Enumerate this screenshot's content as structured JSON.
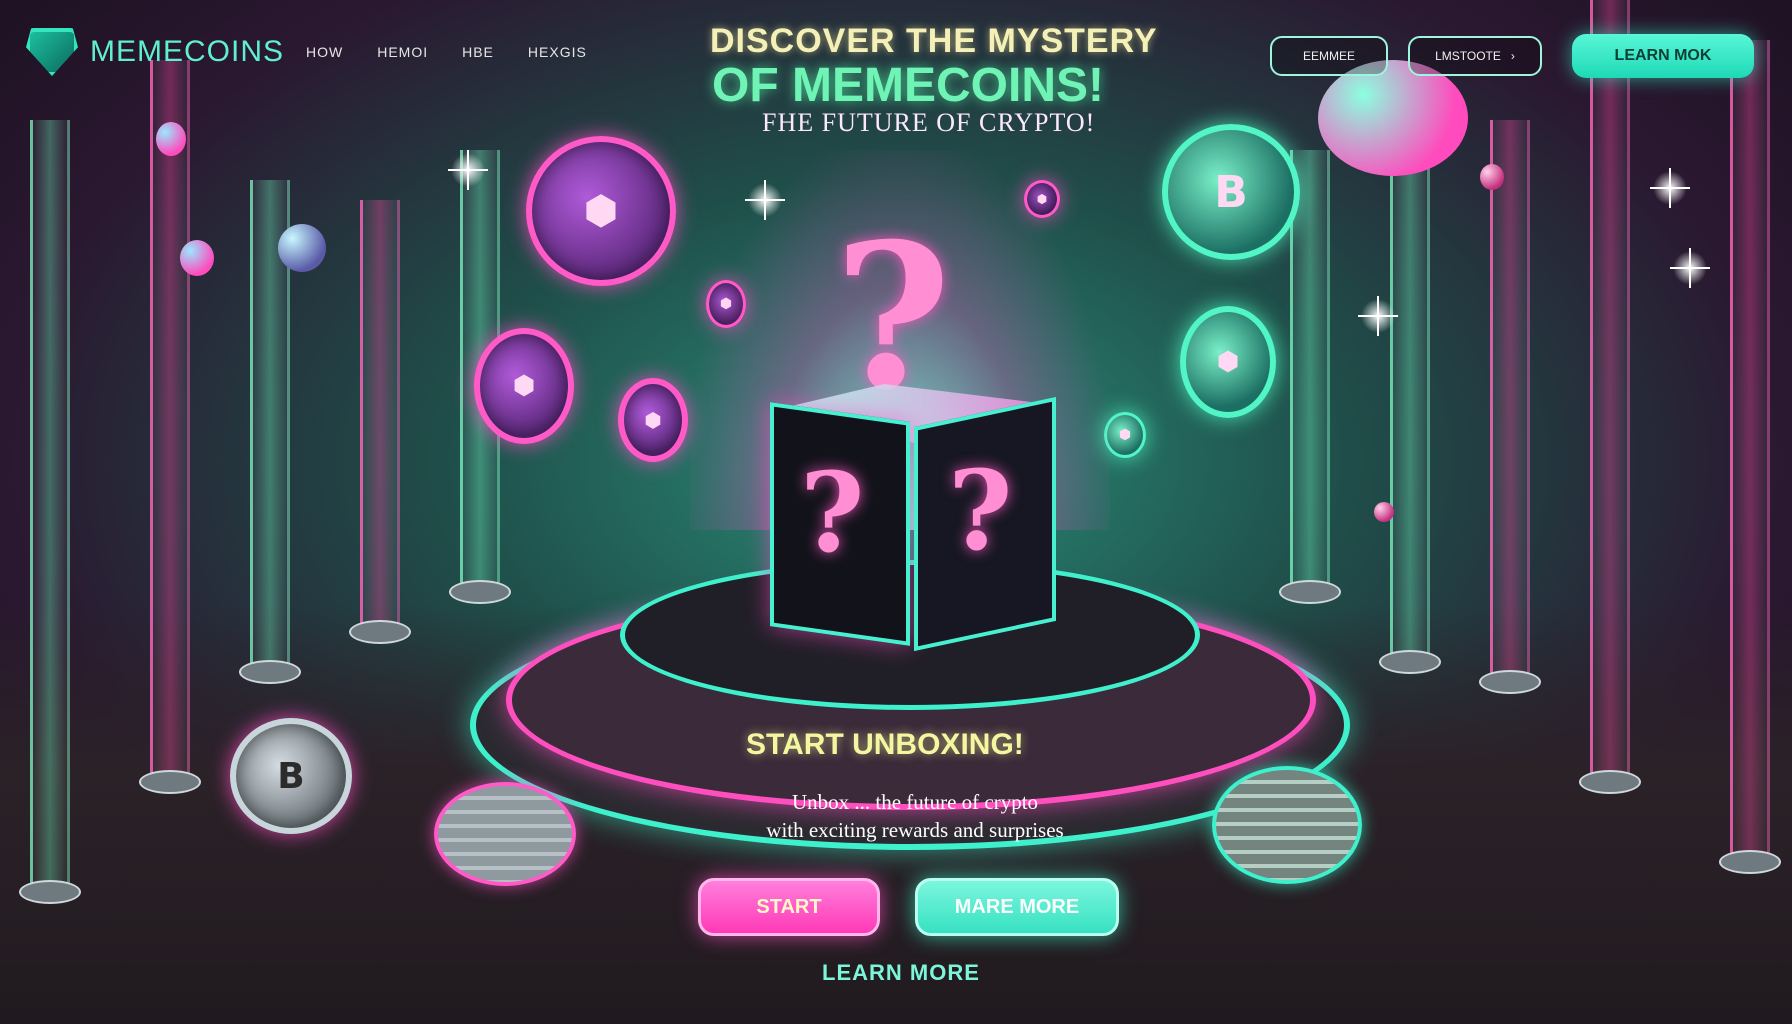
{
  "brand": {
    "name": "MEMECOINS",
    "logo_icon": "shield-logo-icon"
  },
  "nav": {
    "links": [
      "HOW",
      "HEMOI",
      "HBE",
      "HEXGIS"
    ]
  },
  "header_buttons": {
    "button_1": "EEMMEE",
    "button_2": "LMSTOOTE",
    "button_2_arrow": "›",
    "cta": "LEARN MOK"
  },
  "hero": {
    "line1": "DISCOVER THE MYSTERY",
    "line2": "OF MEMECOINS!",
    "line3": "FHE FUTURE OF CRYPTO!"
  },
  "box": {
    "question_mark": "?"
  },
  "coins": {
    "bitcoin_symbol": "B"
  },
  "section": {
    "heading": "START UNBOXING!",
    "tagline_1": "Unbox ... the future of crypto",
    "tagline_2": "with exciting rewards and surprises"
  },
  "actions": {
    "start": "START",
    "more": "MARE MORE",
    "learn_more": "LEARN MORE"
  },
  "colors": {
    "accent_pink": "#ff3ab7",
    "accent_teal": "#37e1c2",
    "title_yellow": "#f4f0b8",
    "title_green": "#6ff4b5"
  }
}
